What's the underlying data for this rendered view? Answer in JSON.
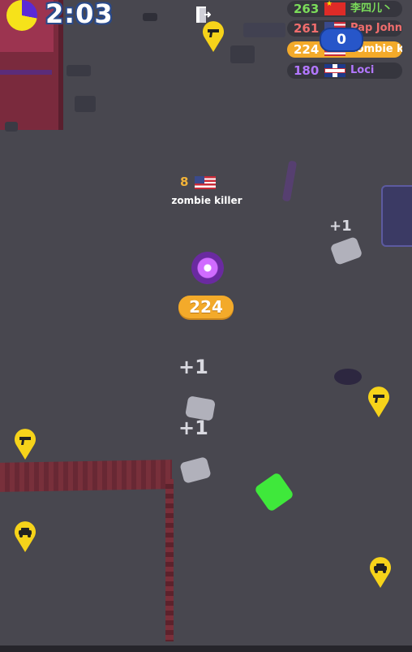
{
  "hud": {
    "timer": "2:03",
    "kills_counter": "0"
  },
  "leaderboard": [
    {
      "score": "263",
      "name": "李四儿丶",
      "color": "#7bdc5a",
      "flag": "cn"
    },
    {
      "score": "261",
      "name": "Pap John",
      "color": "#f06d6d",
      "flag": "us"
    },
    {
      "score": "224",
      "name": "zombie k",
      "color": "#ffffff",
      "flag": "us",
      "self": true
    },
    {
      "score": "180",
      "name": "Loci",
      "color": "#b277ff",
      "flag": "uk"
    }
  ],
  "player": {
    "rank": "8",
    "name": "zombie killer",
    "score": "224"
  },
  "floating_points": [
    "+1",
    "+1",
    "+1"
  ],
  "pins": [
    "gun-pin",
    "gun-pin",
    "gun-pin",
    "car-pin",
    "car-pin"
  ],
  "colors": {
    "ground": "#48474f",
    "accent_orange": "#f3aa2a",
    "pin_yellow": "#f6d31a",
    "zombie_green": "#3fe83b"
  }
}
